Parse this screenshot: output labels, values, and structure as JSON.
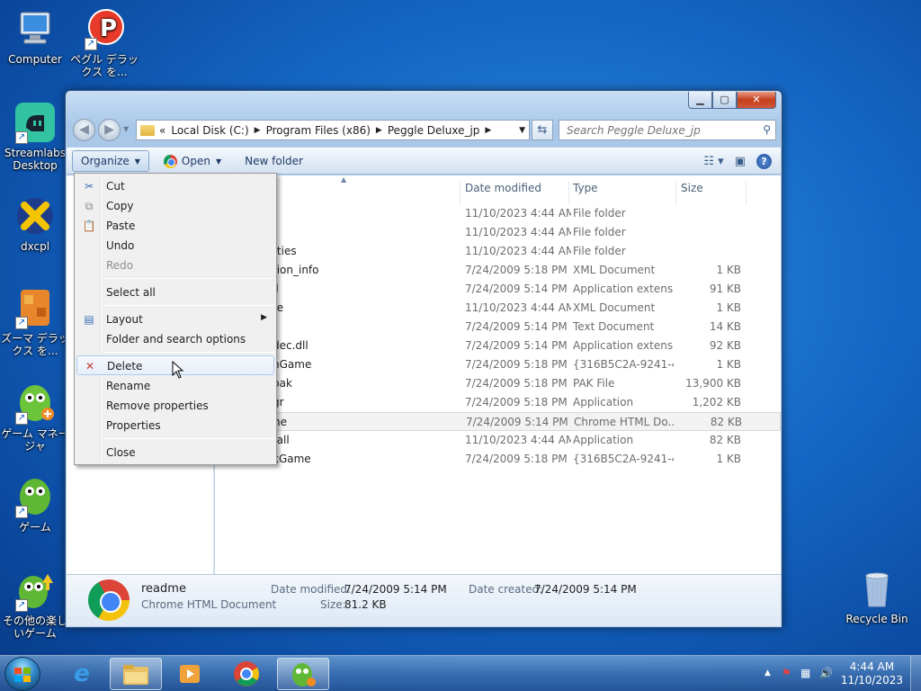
{
  "desktop": {
    "icons": [
      {
        "label": "Computer"
      },
      {
        "label": "ペグル デラックス を..."
      },
      {
        "label": "Streamlabs Desktop"
      },
      {
        "label": "dxcpl"
      },
      {
        "label": "ズーマ デラックス を..."
      },
      {
        "label": "ゲーム マネージャ"
      },
      {
        "label": "ゲーム"
      },
      {
        "label": "その他の楽しいゲーム"
      },
      {
        "label": "Recycle Bin"
      }
    ]
  },
  "window": {
    "address": {
      "overflow": "«",
      "crumbs": [
        "Local Disk (C:)",
        "Program Files (x86)",
        "Peggle Deluxe_jp"
      ]
    },
    "search_placeholder": "Search Peggle Deluxe_jp",
    "toolbar": {
      "organize": "Organize",
      "open": "Open",
      "new_folder": "New folder"
    },
    "columns": {
      "date": "Date modified",
      "type": "Type",
      "size": "Size"
    },
    "files": [
      {
        "name": "",
        "date": "11/10/2023 4:44 AM",
        "type": "File folder",
        "size": ""
      },
      {
        "name": "",
        "date": "11/10/2023 4:44 AM",
        "type": "File folder",
        "size": ""
      },
      {
        "name": "rties",
        "date": "11/10/2023 4:44 AM",
        "type": "File folder",
        "size": ""
      },
      {
        "name": "tion_info",
        "date": "7/24/2009 5:18 PM",
        "type": "XML Document",
        "size": "1 KB"
      },
      {
        "name": "ll",
        "date": "7/24/2009 5:14 PM",
        "type": "Application extens...",
        "size": "91 KB"
      },
      {
        "name": "te",
        "date": "11/10/2023 4:44 AM",
        "type": "XML Document",
        "size": "1 KB"
      },
      {
        "name": "",
        "date": "7/24/2009 5:14 PM",
        "type": "Text Document",
        "size": "14 KB"
      },
      {
        "name": "dec.dll",
        "date": "7/24/2009 5:14 PM",
        "type": "Application extens...",
        "size": "92 KB"
      },
      {
        "name": "hGame",
        "date": "7/24/2009 5:18 PM",
        "type": "{316B5C2A-9241-4...",
        "size": "1 KB"
      },
      {
        "name": "pak",
        "date": "7/24/2009 5:18 PM",
        "type": "PAK File",
        "size": "13,900 KB"
      },
      {
        "name": "gr",
        "date": "7/24/2009 5:18 PM",
        "type": "Application",
        "size": "1,202 KB"
      },
      {
        "name": "ne",
        "date": "7/24/2009 5:14 PM",
        "type": "Chrome HTML Do...",
        "size": "82 KB"
      },
      {
        "name": "tall",
        "date": "11/10/2023 4:44 AM",
        "type": "Application",
        "size": "82 KB"
      },
      {
        "name": "kGame",
        "date": "7/24/2009 5:18 PM",
        "type": "{316B5C2A-9241-4...",
        "size": "1 KB"
      }
    ],
    "details": {
      "name": "readme",
      "type": "Chrome HTML Document",
      "modified_label": "Date modified:",
      "modified_value": "7/24/2009 5:14 PM",
      "created_label": "Date created:",
      "created_value": "7/24/2009 5:14 PM",
      "size_label": "Size:",
      "size_value": "81.2 KB"
    }
  },
  "context_menu": {
    "items": [
      {
        "label": "Cut"
      },
      {
        "label": "Copy"
      },
      {
        "label": "Paste"
      },
      {
        "label": "Undo"
      },
      {
        "label": "Redo"
      },
      {
        "label": "Select all"
      },
      {
        "label": "Layout"
      },
      {
        "label": "Folder and search options"
      },
      {
        "label": "Delete"
      },
      {
        "label": "Rename"
      },
      {
        "label": "Remove properties"
      },
      {
        "label": "Properties"
      },
      {
        "label": "Close"
      }
    ]
  },
  "taskbar": {
    "time": "4:44 AM",
    "date": "11/10/2023"
  },
  "colors": {
    "accent": "#1566c4",
    "delete_icon": "#c0392b"
  }
}
